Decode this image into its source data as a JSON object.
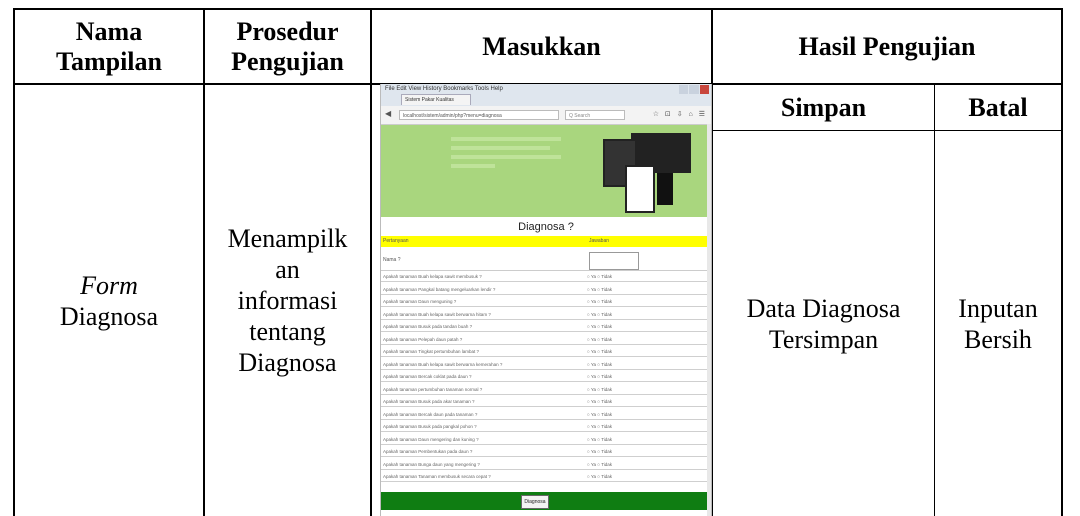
{
  "table": {
    "headers": {
      "nama_tampilan": "Nama Tampilan",
      "prosedur_pengujian": "Prosedur Pengujian",
      "masukkan": "Masukkan",
      "hasil_pengujian": "Hasil Pengujian"
    },
    "sub_headers": {
      "simpan": "Simpan",
      "batal": "Batal"
    },
    "row": {
      "nama_italic": "Form",
      "nama_rest": "Diagnosa",
      "prosedur_lines": [
        "Menampilk",
        "an",
        "informasi",
        "tentang",
        "Diagnosa"
      ],
      "simpan_lines": [
        "Data Diagnosa",
        "Tersimpan"
      ],
      "batal_lines": [
        "Inputan",
        "Bersih"
      ]
    }
  },
  "screenshot": {
    "menu": "File  Edit  View  History  Bookmarks  Tools  Help",
    "tab": "Sistem Pakar Kualitas Kelapa Sa...",
    "url": "localhost/sistem/admin/php?menu=diagnosa",
    "search": "Q Search",
    "toolbar_icons": "☆ ⊡ ⇩ ⌂ ☰",
    "title": "Diagnosa ?",
    "col_pertanyaan": "Pertanyaan",
    "col_jawaban": "Jawaban",
    "nama_label": "Nama ?",
    "answer": "○ Ya ○ Tidak",
    "button": "Diagnosa",
    "questions": [
      "Apakah tanaman Buah kelapa sawit membusuk ?",
      "Apakah tanaman Pangkal batang mengeluarkan lendir ?",
      "Apakah tanaman Daun menguning ?",
      "Apakah tanaman Buah kelapa sawit berwarna hitam ?",
      "Apakah tanaman Busuk pada tandan buah ?",
      "Apakah tanaman Pelepah daun patah ?",
      "Apakah tanaman Tingkat pertumbuhan lambat ?",
      "Apakah tanaman Buah kelapa sawit berwarna kemerahan ?",
      "Apakah tanaman Bercak coklat pada daun ?",
      "Apakah tanaman pertumbuhan tanaman normal ?",
      "Apakah tanaman Busuk pada akar tanaman ?",
      "Apakah tanaman Bercak daun pada tanaman ?",
      "Apakah tanaman Busuk pada pangkal pohon ?",
      "Apakah tanaman Daun mengering dan kuning ?",
      "Apakah tanaman Pembentukan pada daun ?",
      "Apakah tanaman Bunga daun yang mengering ?",
      "Apakah tanaman Tanaman membusuk secara cepat ?"
    ]
  }
}
